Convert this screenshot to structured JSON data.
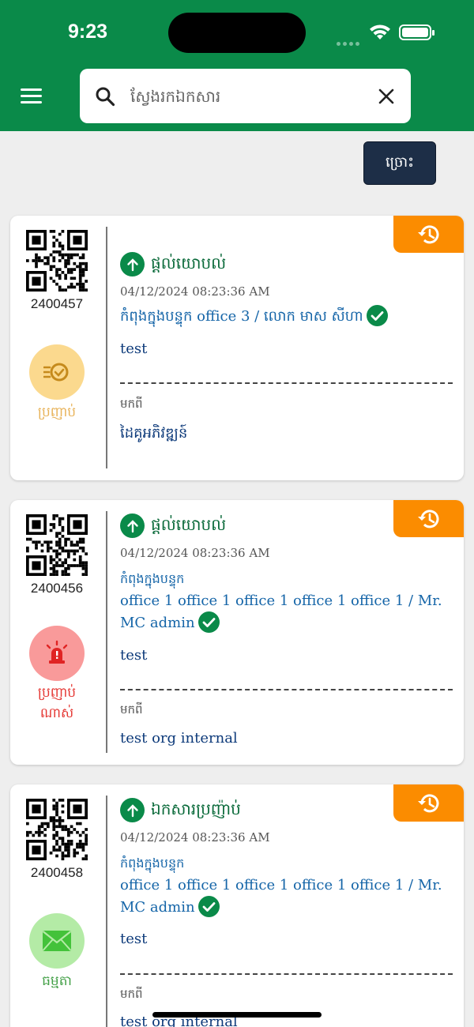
{
  "status_bar": {
    "time": "9:23"
  },
  "header": {
    "search_placeholder": "ស្វែងរកឯកសារ",
    "filter_label": "ច្រោះ"
  },
  "colors": {
    "primary_green": "#0a8a49",
    "history_orange": "#fb8c00",
    "filter_navy": "#1d2e47",
    "link_blue": "#1565a8"
  },
  "cards": [
    {
      "id": "2400457",
      "priority_label": "ប្រញាប់",
      "priority_icon": "fast-clock-icon",
      "priority_color": "#e8b35a",
      "action": "ផ្តល់យោបល់",
      "date": "04/12/2024 08:23:36 AM",
      "location_line1": "កំពុងក្នុងបន្ទុក office 3 / លោក មាស សីហា",
      "location_line2": "",
      "body": "test",
      "from_label": "មកពី",
      "from": "ដៃគូអភិវឌ្ឍន៍"
    },
    {
      "id": "2400456",
      "priority_label": "ប្រញាប់ណាស់",
      "priority_icon": "siren-icon",
      "priority_color": "#e53935",
      "action": "ផ្តល់យោបល់",
      "date": "04/12/2024 08:23:36 AM",
      "location_line1": "កំពុងក្នុងបន្ទុក",
      "location_line2": " office 1 office 1 office 1 office 1 office 1 / Mr. MC admin",
      "body": "test",
      "from_label": "មកពី",
      "from": "test org internal"
    },
    {
      "id": "2400458",
      "priority_label": "ធម្មតា",
      "priority_icon": "envelope-icon",
      "priority_color": "#43a047",
      "action": "ឯកសារប្រញ៉ាប់",
      "date": "04/12/2024 08:23:36 AM",
      "location_line1": "កំពុងក្នុងបន្ទុក",
      "location_line2": " office 1 office 1 office 1 office 1 office 1 / Mr. MC admin",
      "body": "test",
      "from_label": "មកពី",
      "from": "test org internal"
    }
  ]
}
